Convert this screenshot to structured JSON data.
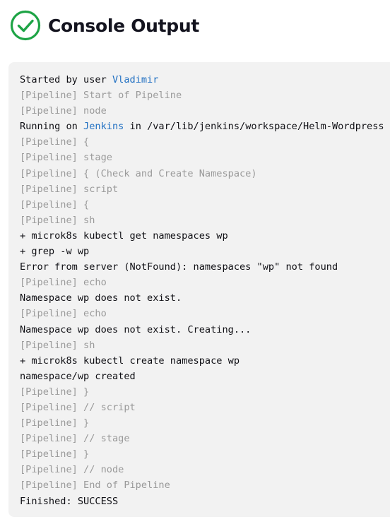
{
  "header": {
    "title": "Console Output",
    "status_icon": "success-check-circle-icon",
    "status_color": "#1ea446"
  },
  "console": {
    "link_color": "#1f6fc2",
    "pipeline_color": "#9a9a9a",
    "started_prefix": "Started by user ",
    "started_user": "Vladimir",
    "running_prefix": "Running on ",
    "running_node": "Jenkins",
    "running_suffix": " in /var/lib/jenkins/workspace/Helm-Wordpress",
    "lines": [
      "[Pipeline] Start of Pipeline",
      "[Pipeline] node",
      "[Pipeline] {",
      "[Pipeline] stage",
      "[Pipeline] { (Check and Create Namespace)",
      "[Pipeline] script",
      "[Pipeline] {",
      "[Pipeline] sh",
      "+ microk8s kubectl get namespaces wp",
      "+ grep -w wp",
      "Error from server (NotFound): namespaces \"wp\" not found",
      "[Pipeline] echo",
      "Namespace wp does not exist.",
      "[Pipeline] echo",
      "Namespace wp does not exist. Creating...",
      "[Pipeline] sh",
      "+ microk8s kubectl create namespace wp",
      "namespace/wp created",
      "[Pipeline] }",
      "[Pipeline] // script",
      "[Pipeline] }",
      "[Pipeline] // stage",
      "[Pipeline] }",
      "[Pipeline] // node",
      "[Pipeline] End of Pipeline",
      "Finished: SUCCESS"
    ]
  }
}
